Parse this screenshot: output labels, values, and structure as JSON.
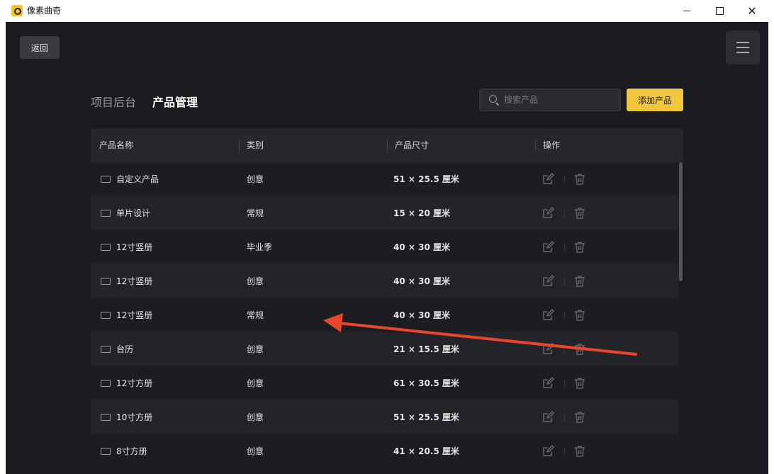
{
  "window": {
    "title": "像素曲奇"
  },
  "toolbar": {
    "back_label": "返回"
  },
  "nav": {
    "inactive_tab": "项目后台",
    "active_tab": "产品管理"
  },
  "search": {
    "placeholder": "搜索产品"
  },
  "actions": {
    "add_label": "添加产品"
  },
  "table": {
    "headers": [
      "产品名称",
      "类别",
      "产品尺寸",
      "操作"
    ],
    "rows": [
      {
        "name": "自定义产品",
        "category": "创意",
        "size": "51 × 25.5 厘米"
      },
      {
        "name": "单片设计",
        "category": "常规",
        "size": "15 × 20 厘米"
      },
      {
        "name": "12寸竖册",
        "category": "毕业季",
        "size": "40 × 30 厘米"
      },
      {
        "name": "12寸竖册",
        "category": "创意",
        "size": "40 × 30 厘米"
      },
      {
        "name": "12寸竖册",
        "category": "常规",
        "size": "40 × 30 厘米"
      },
      {
        "name": "台历",
        "category": "创意",
        "size": "21 × 15.5 厘米"
      },
      {
        "name": "12寸方册",
        "category": "创意",
        "size": "61 × 30.5 厘米"
      },
      {
        "name": "10寸方册",
        "category": "创意",
        "size": "51 × 25.5 厘米"
      },
      {
        "name": "8寸方册",
        "category": "创意",
        "size": "41 × 20.5 厘米"
      }
    ]
  },
  "icons": {
    "app": "app-logo-icon",
    "menu": "hamburger-menu-icon",
    "search": "search-icon",
    "row": "card-icon",
    "edit": "edit-icon",
    "delete": "trash-icon"
  },
  "colors": {
    "background": "#1a1b1f",
    "accent": "#f2c53d",
    "annotation_arrow": "#e8452c"
  }
}
